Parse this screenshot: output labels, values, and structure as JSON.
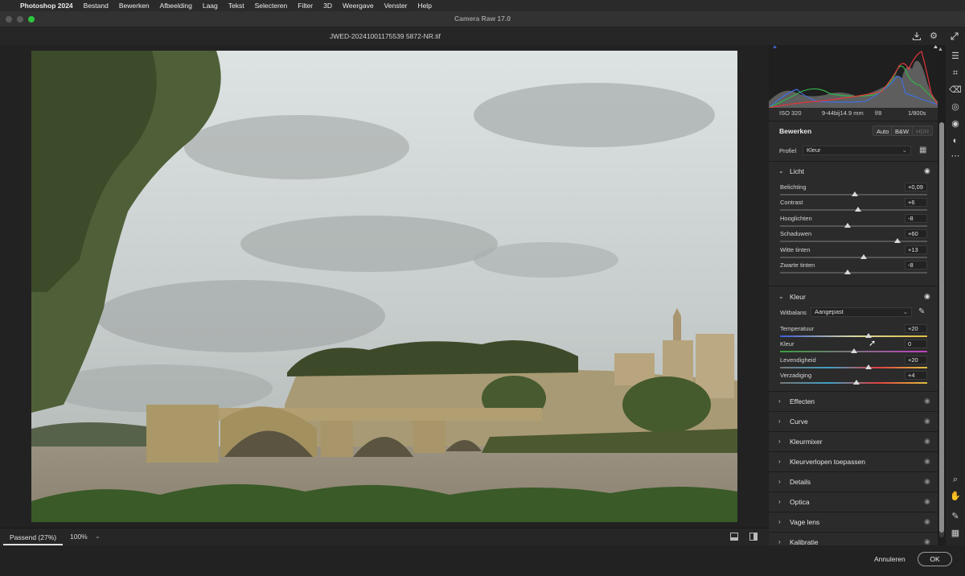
{
  "menubar": {
    "apple": "",
    "app": "Photoshop 2024",
    "items": [
      "Bestand",
      "Bewerken",
      "Afbeelding",
      "Laag",
      "Tekst",
      "Selecteren",
      "Filter",
      "3D",
      "Weergave",
      "Venster",
      "Help"
    ]
  },
  "window": {
    "title": "Camera Raw 17.0"
  },
  "document": {
    "filename": "JWED-20241001175539 5872-NR.tif"
  },
  "histogram": {
    "exif": {
      "iso": "ISO 320",
      "lens": "9-44bij14.9 mm",
      "aperture": "f/8",
      "shutter": "1/800s"
    }
  },
  "edit": {
    "title": "Bewerken",
    "buttons": {
      "auto": "Auto",
      "bw": "B&W",
      "hdr": "HDR"
    },
    "profile_label": "Profiel",
    "profile_value": "Kleur"
  },
  "sections": {
    "light": {
      "name": "Licht",
      "sliders": [
        {
          "label": "Belichting",
          "value": "+0,09",
          "pos": 0.51
        },
        {
          "label": "Contrast",
          "value": "+6",
          "pos": 0.53
        },
        {
          "label": "Hooglichten",
          "value": "-8",
          "pos": 0.46
        },
        {
          "label": "Schaduwen",
          "value": "+60",
          "pos": 0.8
        },
        {
          "label": "Witte tinten",
          "value": "+13",
          "pos": 0.57
        },
        {
          "label": "Zwarte tinten",
          "value": "-8",
          "pos": 0.46
        }
      ]
    },
    "color": {
      "name": "Kleur",
      "wb_label": "Witbalans",
      "wb_value": "Aangepast",
      "sliders": [
        {
          "label": "Temperatuur",
          "value": "+20",
          "pos": 0.6
        },
        {
          "label": "Kleur",
          "value": "0",
          "pos": 0.5
        },
        {
          "label": "Levendigheid",
          "value": "+20",
          "pos": 0.6
        },
        {
          "label": "Verzadiging",
          "value": "+4",
          "pos": 0.52
        }
      ]
    },
    "collapsed": [
      "Effecten",
      "Curve",
      "Kleurmixer",
      "Kleurverlopen toepassen",
      "Details",
      "Optica",
      "Vage lens",
      "Kalibratie"
    ]
  },
  "status": {
    "fit": "Passend (27%)",
    "zoom": "100%"
  },
  "footer": {
    "cancel": "Annuleren",
    "ok": "OK"
  },
  "colors": {
    "panel": "#2b2b2b",
    "canvas": "#222222",
    "accent": "#d8d8d8"
  }
}
